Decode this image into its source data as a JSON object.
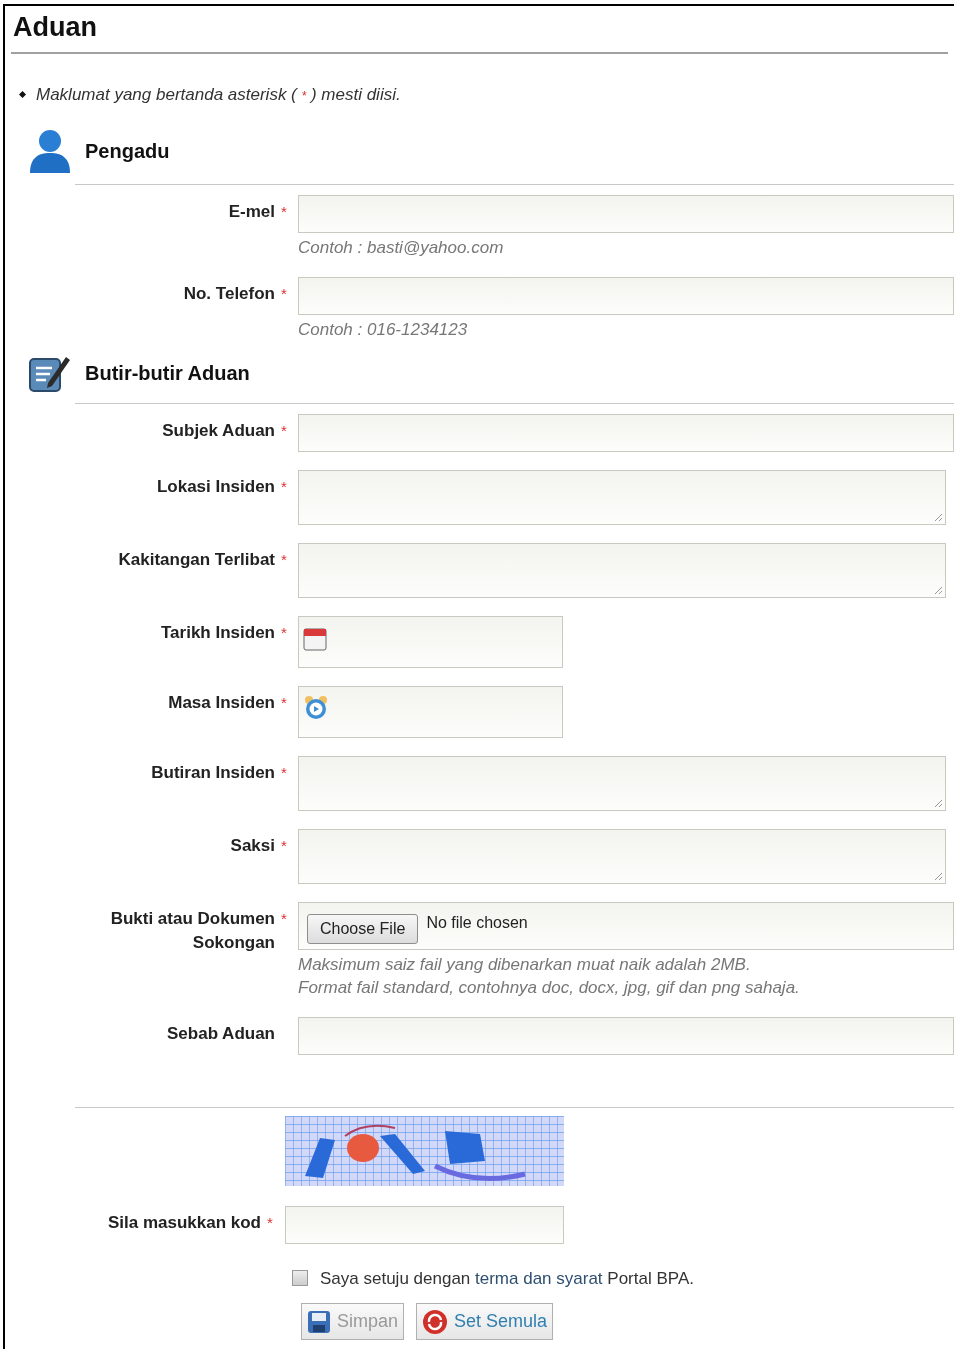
{
  "title": "Aduan",
  "note": {
    "before": "Maklumat yang bertanda asterisk (",
    "mark": "*",
    "after": ") mesti diisi."
  },
  "sections": [
    {
      "title": "Pengadu",
      "fields": [
        {
          "label": "E-mel",
          "asterisk": "*",
          "kind": "text",
          "hints": [
            "Contoh : basti@yahoo.com"
          ]
        },
        {
          "label": "No. Telefon",
          "asterisk": "*",
          "kind": "text",
          "hints": [
            "Contoh : 016-1234123"
          ]
        }
      ]
    },
    {
      "title": "Butir-butir Aduan",
      "fields": [
        {
          "label": "Subjek Aduan",
          "asterisk": "*",
          "kind": "text"
        },
        {
          "label": "Lokasi Insiden",
          "asterisk": "*",
          "kind": "textarea"
        },
        {
          "label": "Kakitangan Terlibat",
          "asterisk": "*",
          "kind": "textarea"
        },
        {
          "label": "Tarikh Insiden",
          "asterisk": "*",
          "kind": "date"
        },
        {
          "label": "Masa Insiden",
          "asterisk": "*",
          "kind": "time"
        },
        {
          "label": "Butiran Insiden",
          "asterisk": "*",
          "kind": "textarea"
        },
        {
          "label": "Saksi",
          "asterisk": "*",
          "kind": "textarea"
        },
        {
          "label": "Bukti atau Dokumen Sokongan",
          "asterisk": "*",
          "kind": "file",
          "button": "Choose File",
          "status": "No file chosen",
          "hints": [
            "Maksimum saiz fail yang dibenarkan muat naik adalah 2MB.",
            "Format fail standard, contohnya doc, docx, jpg, gif dan png sahaja."
          ]
        },
        {
          "label": "Sebab Aduan",
          "kind": "text"
        }
      ]
    }
  ],
  "captcha": {
    "kind": "picture",
    "label": "Sila masukkan kod",
    "asterisk": "*"
  },
  "agreement": {
    "checked": false,
    "before": "Saya setuju dengan",
    "link": "terma dan syarat",
    "after": "Portal BPA."
  },
  "buttons": [
    {
      "label": "Simpan",
      "disabled": true
    },
    {
      "label": "Set Semula",
      "disabled": false
    }
  ]
}
